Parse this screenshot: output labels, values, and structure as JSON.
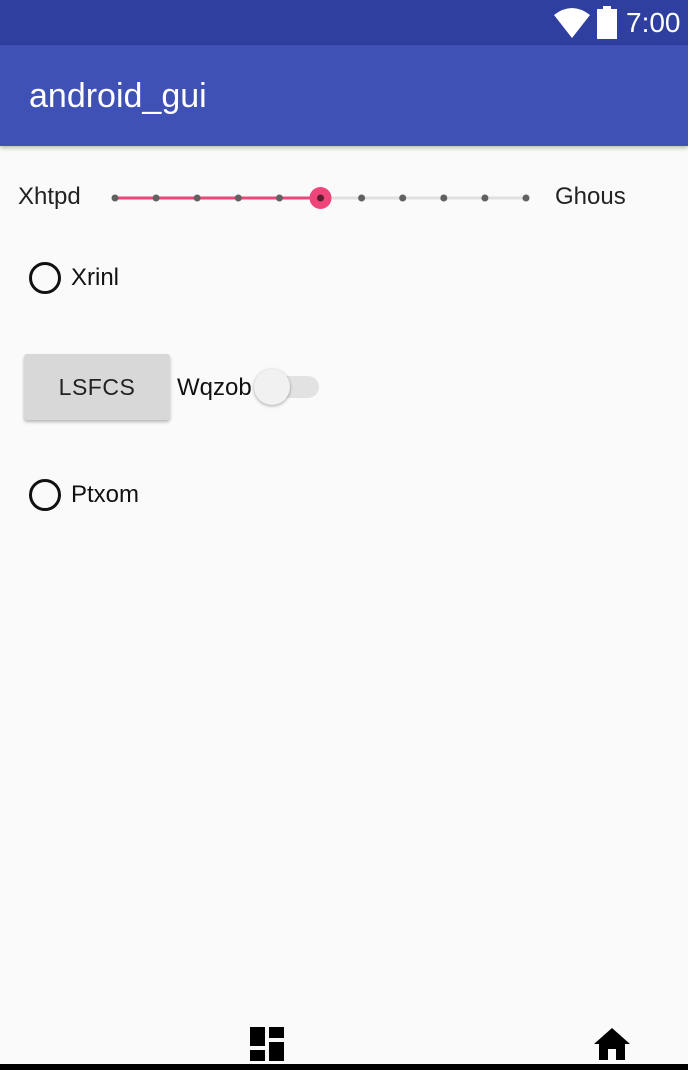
{
  "status_bar": {
    "time": "7:00",
    "icons": [
      "wifi-icon",
      "battery-icon"
    ],
    "background_color": "#2f3f9f"
  },
  "app_bar": {
    "title": "android_gui",
    "background_color": "#3f51b5"
  },
  "seekbar": {
    "left_label": "Xhtpd",
    "right_label": "Ghous",
    "steps": 10,
    "progress": 5,
    "accent_color": "#f0457a"
  },
  "radio_1": {
    "label": "Xrinl",
    "checked": false
  },
  "button": {
    "label": "LSFCS"
  },
  "switch": {
    "label": "Wqzob",
    "checked": false
  },
  "radio_2": {
    "label": "Ptxom",
    "checked": false
  },
  "bottom_nav": {
    "icons": [
      "dashboard-icon",
      "home-icon"
    ]
  }
}
